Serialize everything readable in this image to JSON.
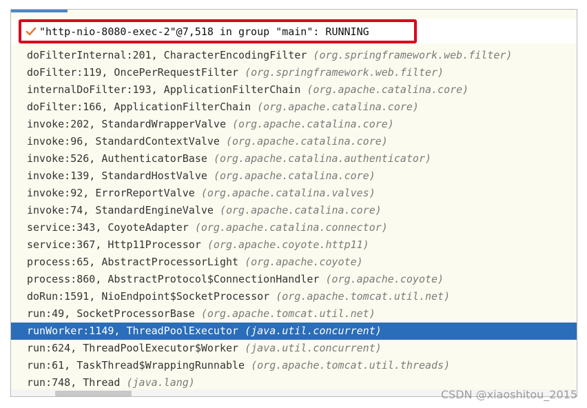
{
  "thread": {
    "status_icon": "check-icon",
    "title": "\"http-nio-8080-exec-2\"@7,518 in group \"main\": RUNNING"
  },
  "frames": [
    {
      "method": "doFilterInternal:201, CharacterEncodingFilter ",
      "package": "(org.springframework.web.filter)"
    },
    {
      "method": "doFilter:119, OncePerRequestFilter ",
      "package": "(org.springframework.web.filter)"
    },
    {
      "method": "internalDoFilter:193, ApplicationFilterChain ",
      "package": "(org.apache.catalina.core)"
    },
    {
      "method": "doFilter:166, ApplicationFilterChain ",
      "package": "(org.apache.catalina.core)"
    },
    {
      "method": "invoke:202, StandardWrapperValve ",
      "package": "(org.apache.catalina.core)"
    },
    {
      "method": "invoke:96, StandardContextValve ",
      "package": "(org.apache.catalina.core)"
    },
    {
      "method": "invoke:526, AuthenticatorBase ",
      "package": "(org.apache.catalina.authenticator)"
    },
    {
      "method": "invoke:139, StandardHostValve ",
      "package": "(org.apache.catalina.core)"
    },
    {
      "method": "invoke:92, ErrorReportValve ",
      "package": "(org.apache.catalina.valves)"
    },
    {
      "method": "invoke:74, StandardEngineValve ",
      "package": "(org.apache.catalina.core)"
    },
    {
      "method": "service:343, CoyoteAdapter ",
      "package": "(org.apache.catalina.connector)"
    },
    {
      "method": "service:367, Http11Processor ",
      "package": "(org.apache.coyote.http11)"
    },
    {
      "method": "process:65, AbstractProcessorLight ",
      "package": "(org.apache.coyote)"
    },
    {
      "method": "process:860, AbstractProtocol$ConnectionHandler ",
      "package": "(org.apache.coyote)"
    },
    {
      "method": "doRun:1591, NioEndpoint$SocketProcessor ",
      "package": "(org.apache.tomcat.util.net)"
    },
    {
      "method": "run:49, SocketProcessorBase ",
      "package": "(org.apache.tomcat.util.net)"
    },
    {
      "method": "runWorker:1149, ThreadPoolExecutor ",
      "package": "(java.util.concurrent)",
      "selected": true
    },
    {
      "method": "run:624, ThreadPoolExecutor$Worker ",
      "package": "(java.util.concurrent)"
    },
    {
      "method": "run:61, TaskThread$WrappingRunnable ",
      "package": "(org.apache.tomcat.util.threads)"
    },
    {
      "method": "run:748, Thread ",
      "package": "(java.lang)"
    }
  ],
  "colors": {
    "selection": "#2a6db8",
    "highlight_box": "#d9001b",
    "check": "#e07b39",
    "background": "#fbfbef"
  },
  "watermark": "CSDN @xiaoshitou_2015"
}
